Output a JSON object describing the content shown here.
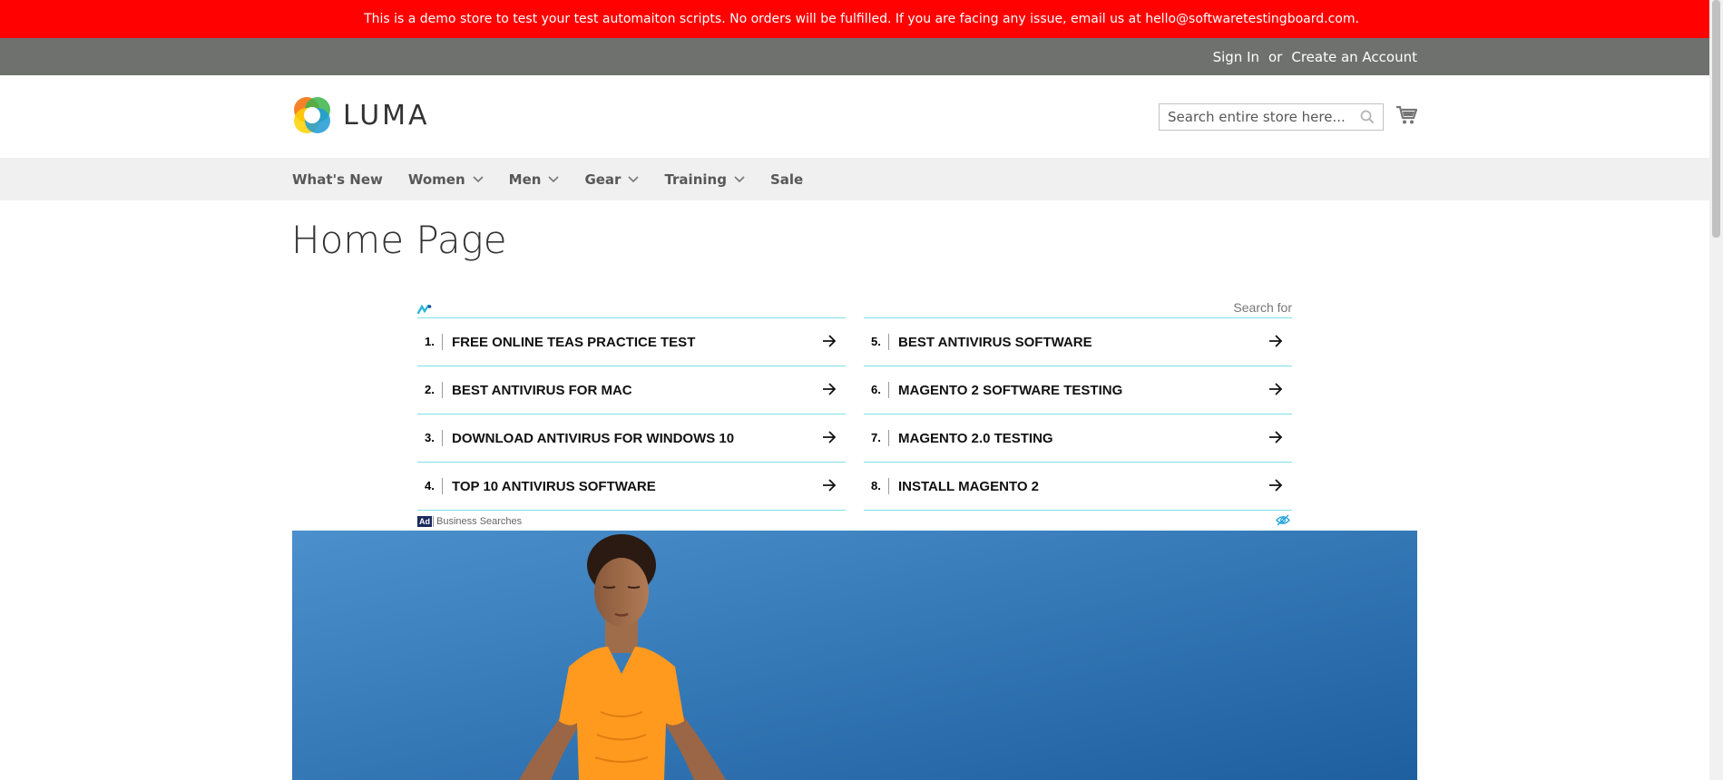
{
  "demo_banner": {
    "text": "This is a demo store to test your test automaiton scripts. No orders will be fulfilled. If you are facing any issue, email us at hello@softwaretestingboard.com."
  },
  "top_links": {
    "sign_in": "Sign In",
    "or": "or",
    "create_account": "Create an Account"
  },
  "header": {
    "logo_text": "LUMA",
    "search_placeholder": "Search entire store here..."
  },
  "nav": {
    "items": [
      {
        "label": "What's New",
        "has_dropdown": false
      },
      {
        "label": "Women",
        "has_dropdown": true
      },
      {
        "label": "Men",
        "has_dropdown": true
      },
      {
        "label": "Gear",
        "has_dropdown": true
      },
      {
        "label": "Training",
        "has_dropdown": true
      },
      {
        "label": "Sale",
        "has_dropdown": false
      }
    ]
  },
  "page": {
    "title": "Home Page"
  },
  "ad": {
    "search_for": "Search for",
    "badge": "Ad",
    "footer_text": "Business Searches",
    "left": [
      {
        "num": "1.",
        "text": "FREE ONLINE TEAS PRACTICE TEST"
      },
      {
        "num": "2.",
        "text": "BEST ANTIVIRUS FOR MAC"
      },
      {
        "num": "3.",
        "text": "DOWNLOAD ANTIVIRUS FOR WINDOWS 10"
      },
      {
        "num": "4.",
        "text": "TOP 10 ANTIVIRUS SOFTWARE"
      }
    ],
    "right": [
      {
        "num": "5.",
        "text": "BEST ANTIVIRUS SOFTWARE"
      },
      {
        "num": "6.",
        "text": "MAGENTO 2 SOFTWARE TESTING"
      },
      {
        "num": "7.",
        "text": "MAGENTO 2.0 TESTING"
      },
      {
        "num": "8.",
        "text": "INSTALL MAGENTO 2"
      }
    ]
  },
  "colors": {
    "banner": "#ff0101",
    "top_bar": "#6e716e",
    "nav_bg": "#f0f0f0",
    "ad_divider": "#7fe0e6",
    "hero_sky": "#2f7bc0",
    "shirt": "#ff9a1f"
  }
}
